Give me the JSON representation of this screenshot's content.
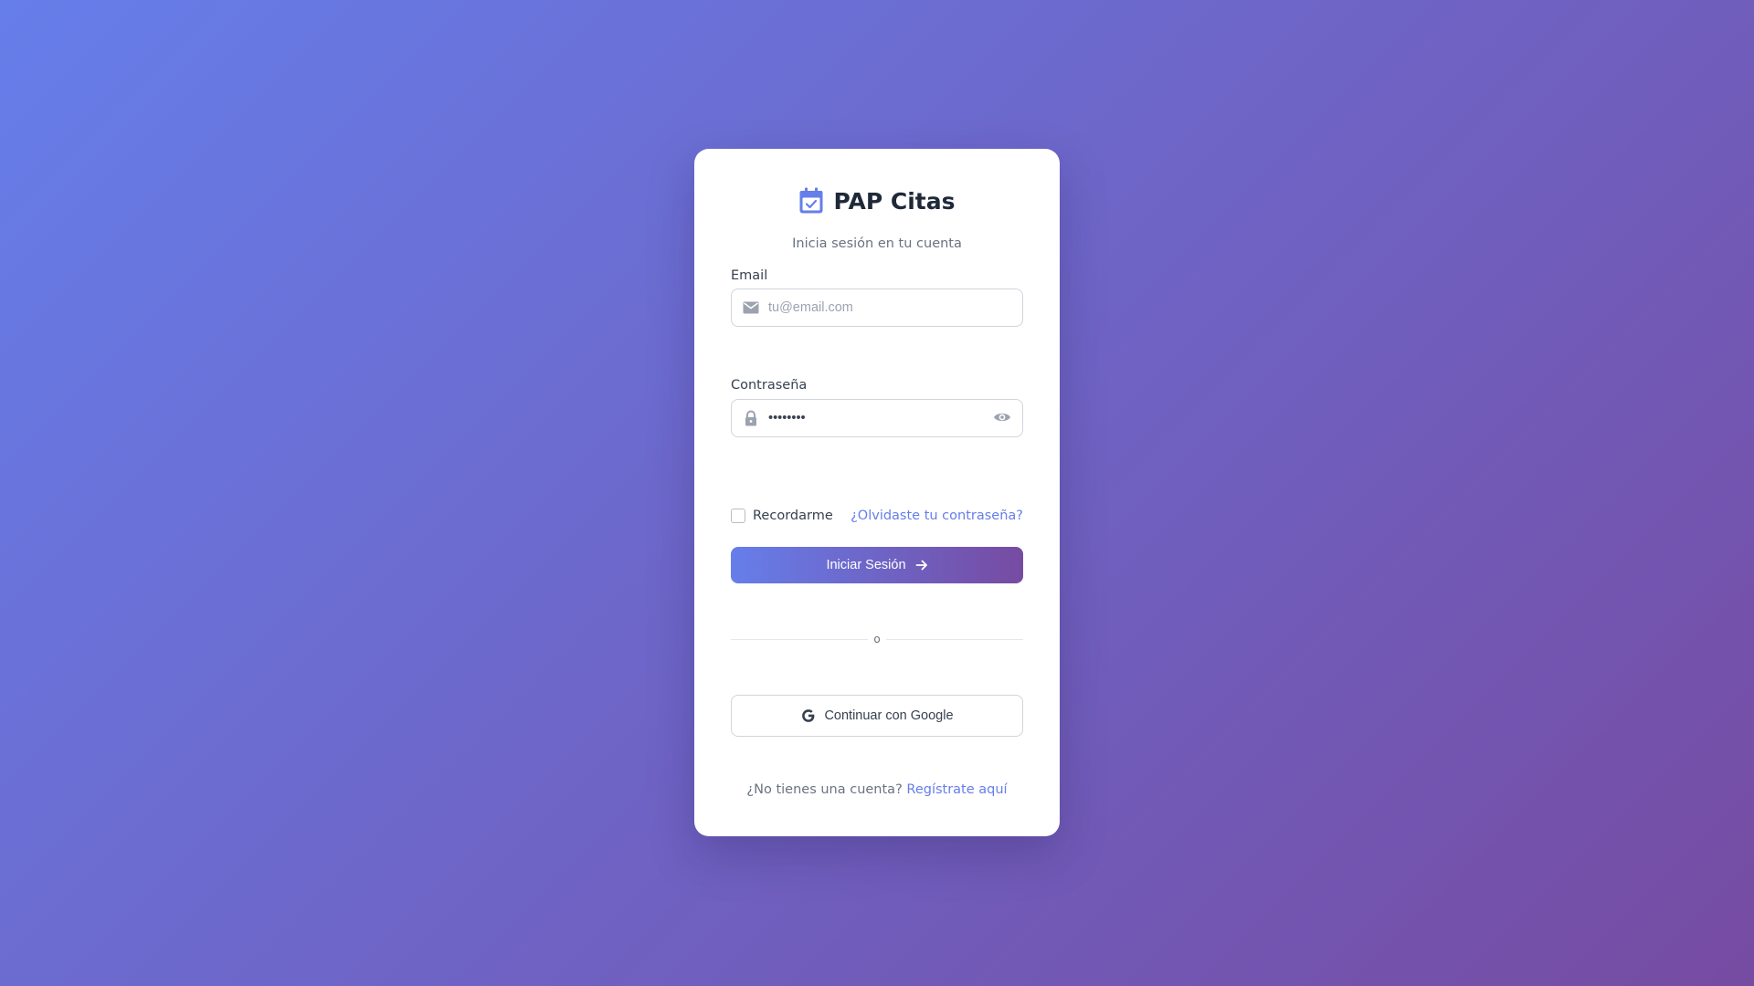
{
  "app": {
    "title": "PAP Citas",
    "subtitle": "Inicia sesión en tu cuenta",
    "brand_icon": "calendar-check-icon"
  },
  "colors": {
    "accent": "#667eea",
    "accent_end": "#764ba2",
    "text_dark": "#1f2937",
    "text_muted": "#6b7280"
  },
  "form": {
    "email": {
      "label": "Email",
      "placeholder": "tu@email.com",
      "value": "",
      "icon": "envelope-icon"
    },
    "password": {
      "label": "Contraseña",
      "value": "••••••••",
      "icon": "lock-icon",
      "toggle_icon": "eye-icon"
    },
    "remember": {
      "label": "Recordarme",
      "checked": false
    },
    "forgot_link": "¿Olvidaste tu contraseña?",
    "submit_label": "Iniciar Sesión",
    "submit_icon": "arrow-right-icon"
  },
  "divider_text": "o",
  "google": {
    "label": "Continuar con Google",
    "icon": "google-icon"
  },
  "footer": {
    "prompt": "¿No tienes una cuenta?",
    "register_link": "Regístrate aquí"
  }
}
